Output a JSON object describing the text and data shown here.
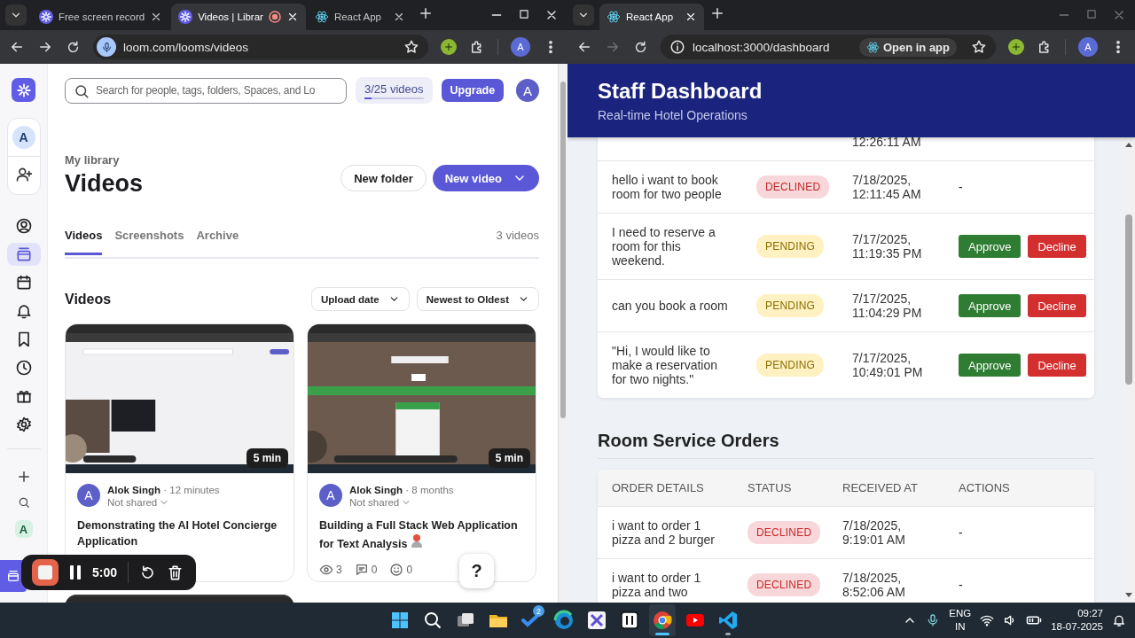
{
  "left_window": {
    "focused": true,
    "forward_enabled": true,
    "tabs": [
      {
        "title": "Free screen record",
        "selected": false,
        "recording": false,
        "kind": "loom"
      },
      {
        "title": "Videos | Librar",
        "selected": true,
        "recording": true,
        "kind": "loom"
      },
      {
        "title": "React App",
        "selected": false,
        "recording": false,
        "kind": "react"
      }
    ],
    "address": "loom.com/looms/videos",
    "profile": "A"
  },
  "loom": {
    "search_placeholder": "Search for people, tags, folders, Spaces, and Lo",
    "usage": {
      "label": "3/25 videos",
      "level": 0.12
    },
    "upgrade": "Upgrade",
    "avatar": "A",
    "sidebar": {
      "account": "A",
      "items": [
        {
          "selected": false
        },
        {
          "selected": true
        },
        {
          "selected": false
        },
        {
          "selected": false
        },
        {
          "selected": false
        },
        {
          "selected": false
        },
        {
          "selected": false
        },
        {
          "selected": false
        }
      ],
      "quick_account": "A"
    },
    "breadcrumb": "My library",
    "title": "Videos",
    "new_folder": "New folder",
    "new_video": "New video",
    "tabs": [
      {
        "label": "Videos",
        "selected": true
      },
      {
        "label": "Screenshots",
        "selected": false
      },
      {
        "label": "Archive",
        "selected": false
      }
    ],
    "count": "3 videos",
    "section_title": "Videos",
    "sort_buttons": [
      "Upload date",
      "Newest to Oldest"
    ],
    "videos": [
      {
        "kind": "card",
        "duration": "5 min",
        "avatar": "A",
        "author": "Alok Singh",
        "separator": "·",
        "age": "12 minutes",
        "sharing": "Not shared",
        "title": "Demonstrating the AI Hotel Concierge Application"
      },
      {
        "kind": "card",
        "duration": "5 min",
        "avatar": "A",
        "author": "Alok Singh",
        "separator": "·",
        "age": "8 months",
        "sharing": "Not shared",
        "title": "Building a Full Stack Web Application for Text Analysis",
        "stats": [
          "3",
          "0",
          "0"
        ]
      },
      {
        "kind": "peek"
      }
    ],
    "recorder": {
      "time": "5:00"
    },
    "help": "?"
  },
  "right_window": {
    "focused": false,
    "forward_enabled": false,
    "tabs": [
      {
        "title": "React App",
        "selected": true,
        "recording": false,
        "kind": "react"
      }
    ],
    "address": "localhost:3000/dashboard",
    "open_in_app": "Open in app",
    "profile": "A"
  },
  "dashboard": {
    "title": "Staff Dashboard",
    "subtitle": "Real-time Hotel Operations",
    "requests": [
      {
        "time": "12:26:11 AM"
      },
      {
        "message": "hello i want to book room for two people",
        "status": "DECLINED",
        "kind": "declined",
        "date": "7/18/2025,",
        "time": "12:11:45 AM",
        "no_action": "-"
      },
      {
        "message": "I need to reserve a room for this weekend.",
        "status": "PENDING",
        "kind": "pending",
        "date": "7/17/2025,",
        "time": "11:19:35 PM",
        "actions": [
          {
            "label": "Approve",
            "kind": "approve"
          },
          {
            "label": "Decline",
            "kind": "decline"
          }
        ]
      },
      {
        "message": "can you book a room",
        "status": "PENDING",
        "kind": "pending",
        "date": "7/17/2025,",
        "time": "11:04:29 PM",
        "actions": [
          {
            "label": "Approve",
            "kind": "approve"
          },
          {
            "label": "Decline",
            "kind": "decline"
          }
        ]
      },
      {
        "message": "\"Hi, I would like to make a reservation for two nights.\"",
        "status": "PENDING",
        "kind": "pending",
        "date": "7/17/2025,",
        "time": "10:49:01 PM",
        "actions": [
          {
            "label": "Approve",
            "kind": "approve"
          },
          {
            "label": "Decline",
            "kind": "decline"
          }
        ]
      }
    ],
    "orders": {
      "title": "Room Service Orders",
      "columns": [
        "ORDER DETAILS",
        "STATUS",
        "RECEIVED AT",
        "ACTIONS"
      ],
      "rows": [
        {
          "message": "i want to order 1 pizza and 2 burger",
          "status": "DECLINED",
          "kind": "declined",
          "date": "7/18/2025,",
          "time": "9:19:01 AM",
          "no_action": "-"
        },
        {
          "message": "i want to order 1 pizza and two",
          "status": "DECLINED",
          "kind": "declined",
          "date": "7/18/2025,",
          "time": "8:52:06 AM",
          "no_action": "-"
        }
      ]
    }
  },
  "taskbar": {
    "apps": [
      {
        "selected": false
      },
      {
        "selected": false
      },
      {
        "selected": false
      },
      {
        "selected": false
      },
      {
        "selected": false,
        "badge": "2"
      },
      {
        "selected": false
      },
      {
        "selected": false
      },
      {
        "selected": false
      },
      {
        "selected": true
      },
      {
        "selected": false
      },
      {
        "selected": false,
        "running": true
      }
    ],
    "language": "ENG",
    "region": "IN",
    "time": "09:27",
    "date": "18-07-2025"
  }
}
